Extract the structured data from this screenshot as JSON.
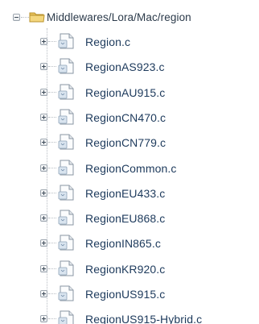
{
  "tree": {
    "root": {
      "label": "Middlewares/Lora/Mac/region",
      "icon": "folder-icon",
      "expanded": true
    },
    "items": [
      {
        "label": "Region.c",
        "icon": "c-source-file-icon"
      },
      {
        "label": "RegionAS923.c",
        "icon": "c-source-file-icon"
      },
      {
        "label": "RegionAU915.c",
        "icon": "c-source-file-icon"
      },
      {
        "label": "RegionCN470.c",
        "icon": "c-source-file-icon"
      },
      {
        "label": "RegionCN779.c",
        "icon": "c-source-file-icon"
      },
      {
        "label": "RegionCommon.c",
        "icon": "c-source-file-icon"
      },
      {
        "label": "RegionEU433.c",
        "icon": "c-source-file-icon"
      },
      {
        "label": "RegionEU868.c",
        "icon": "c-source-file-icon"
      },
      {
        "label": "RegionIN865.c",
        "icon": "c-source-file-icon"
      },
      {
        "label": "RegionKR920.c",
        "icon": "c-source-file-icon"
      },
      {
        "label": "RegionUS915.c",
        "icon": "c-source-file-icon"
      },
      {
        "label": "RegionUS915-Hybrid.c",
        "icon": "c-source-file-icon"
      }
    ],
    "colors": {
      "text": "#1d3a5c",
      "folder": "#e8c15a",
      "tree_lines": "#b9bec4"
    }
  }
}
